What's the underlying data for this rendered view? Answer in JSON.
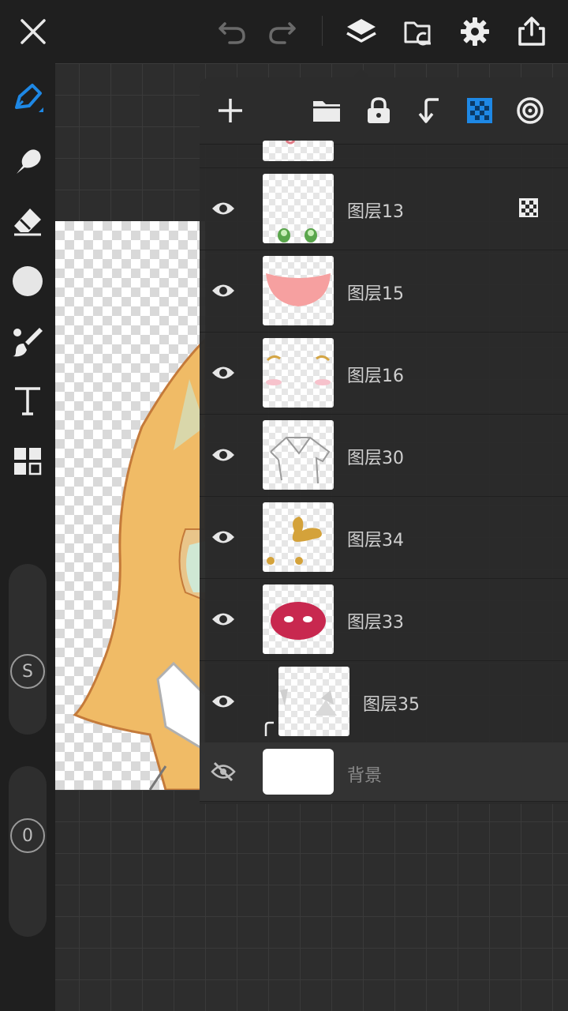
{
  "topbar": {
    "icons": [
      "close-icon",
      "undo-icon",
      "redo-icon",
      "layers-icon",
      "import-folder-icon",
      "gear-icon",
      "share-icon"
    ]
  },
  "toolbar": {
    "tools": [
      "pen-icon",
      "smudge-icon",
      "eraser-icon",
      "color-circle-icon",
      "brush-library-icon",
      "text-icon",
      "grid-icon"
    ],
    "active_tool": "pen-icon",
    "size_label": "S",
    "opacity_label": "0"
  },
  "layer_panel": {
    "header_icons": [
      "add-icon",
      "folder-icon",
      "lock-icon",
      "clipping-icon",
      "alpha-lock-icon",
      "reference-icon"
    ],
    "layers": [
      {
        "name": "图层13",
        "visible": true,
        "alpha_locked": true
      },
      {
        "name": "图层15",
        "visible": true
      },
      {
        "name": "图层16",
        "visible": true
      },
      {
        "name": "图层30",
        "visible": true
      },
      {
        "name": "图层34",
        "visible": true
      },
      {
        "name": "图层33",
        "visible": true
      },
      {
        "name": "图层35",
        "visible": true,
        "clipped": true
      },
      {
        "name": "背景",
        "visible": false,
        "background": true
      }
    ]
  },
  "colors": {
    "accent": "#1e88e5",
    "panel": "#2c2c2c",
    "bar": "#1f1f1f"
  }
}
